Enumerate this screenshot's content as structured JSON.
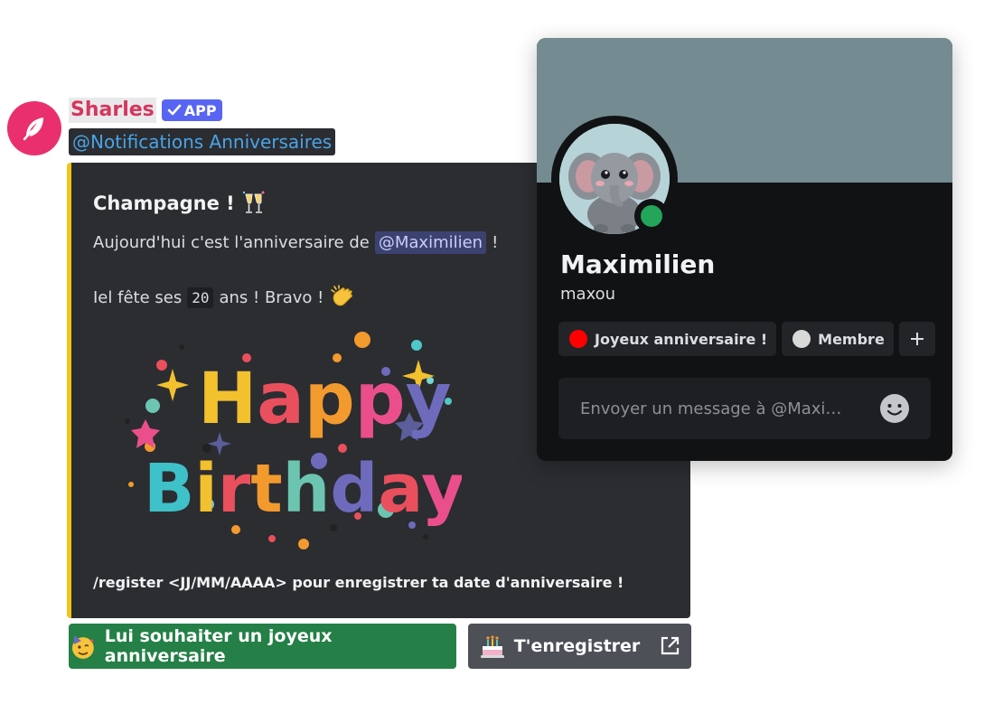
{
  "message": {
    "author": "Sharles",
    "badge": "APP",
    "role_mention": "@Notifications Anniversaires",
    "avatar_icon": "feather-icon",
    "avatar_color": "#ea2f6f",
    "name_color": "#d4375d"
  },
  "embed": {
    "accent_color": "#f0c419",
    "title": "Champagne !",
    "line1_prefix": "Aujourd'hui c'est l'anniversaire de",
    "line1_mention": "@Maximilien",
    "line1_suffix": "!",
    "line2_prefix": "Iel fête ses",
    "line2_age": "20",
    "line2_suffix": "ans ! Bravo !",
    "image_text_top": "Happy",
    "image_text_bottom": "Birthday!",
    "footer": "/register <JJ/MM/AAAA> pour enregistrer ta date d'anniversaire !"
  },
  "buttons": {
    "wish_label": "Lui souhaiter un joyeux anniversaire",
    "register_label": "T'enregistrer",
    "wish_color": "#248046",
    "register_color": "#4e5058"
  },
  "profile": {
    "display_name": "Maximilien",
    "username": "maxou",
    "status": "online",
    "banner_color": "#748b92",
    "roles": [
      {
        "name": "Joyeux anniversaire !",
        "color": "#ff0000"
      },
      {
        "name": "Membre",
        "color": "#d9d9d9"
      }
    ],
    "message_placeholder": "Envoyer un message à @Maxi…"
  }
}
